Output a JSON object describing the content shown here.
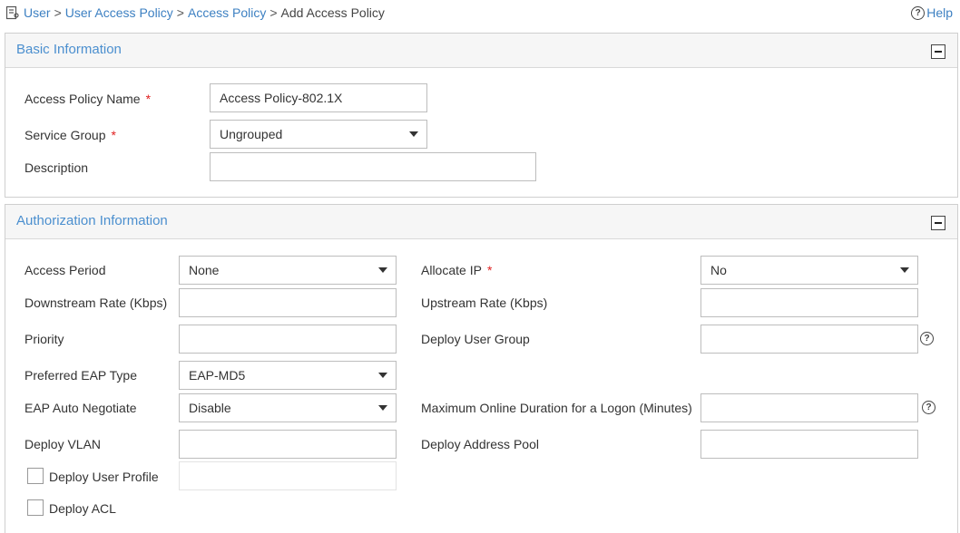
{
  "breadcrumb": {
    "items": [
      "User",
      "User Access Policy",
      "Access Policy"
    ],
    "separator": ">",
    "current": "Add Access Policy"
  },
  "help": {
    "label": "Help",
    "icon": "question-circle-icon"
  },
  "basic": {
    "title": "Basic Information",
    "fields": {
      "name_label": "Access Policy Name",
      "name_value": "Access Policy-802.1X",
      "service_group_label": "Service Group",
      "service_group_value": "Ungrouped",
      "description_label": "Description",
      "description_value": ""
    }
  },
  "auth": {
    "title": "Authorization Information",
    "access_period_label": "Access Period",
    "access_period_value": "None",
    "allocate_ip_label": "Allocate IP",
    "allocate_ip_value": "No",
    "downstream_label": "Downstream Rate (Kbps)",
    "downstream_value": "",
    "upstream_label": "Upstream Rate (Kbps)",
    "upstream_value": "",
    "priority_label": "Priority",
    "priority_value": "",
    "deploy_user_group_label": "Deploy User Group",
    "deploy_user_group_value": "",
    "eap_type_label": "Preferred EAP Type",
    "eap_type_value": "EAP-MD5",
    "eap_auto_label": "EAP Auto Negotiate",
    "eap_auto_value": "Disable",
    "max_online_label": "Maximum Online Duration for a Logon (Minutes)",
    "max_online_value": "",
    "deploy_vlan_label": "Deploy VLAN",
    "deploy_vlan_value": "",
    "deploy_pool_label": "Deploy Address Pool",
    "deploy_pool_value": "",
    "deploy_profile_label": "Deploy User Profile",
    "deploy_profile_checked": false,
    "deploy_acl_label": "Deploy ACL",
    "deploy_acl_checked": false
  },
  "required_mark": "*",
  "colors": {
    "link": "#3d80c2",
    "panel_title": "#4b8fcf",
    "required": "#e02020"
  }
}
